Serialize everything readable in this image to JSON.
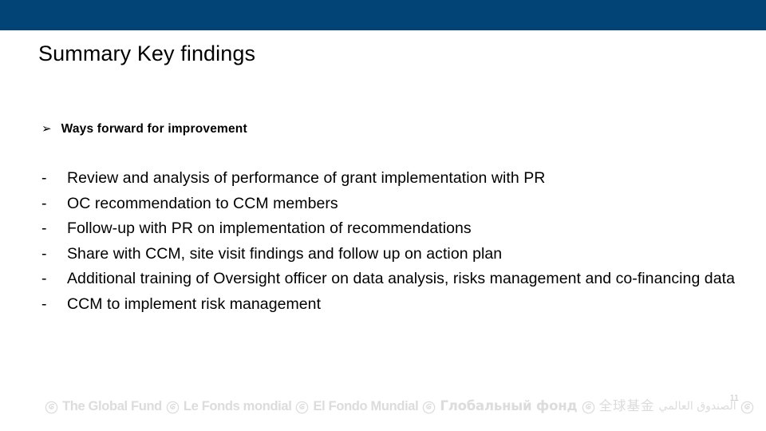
{
  "slide": {
    "title": "Summary Key findings",
    "headline": {
      "bullet_icon": "chevron-right-arrow-icon",
      "bullet_glyph": "➢",
      "text": "Ways forward for improvement"
    },
    "dash_mark": "-",
    "items": [
      "Review and analysis of performance of grant implementation with PR",
      "OC recommendation to CCM members",
      "Follow-up with PR on implementation of recommendations",
      "Share with CCM, site visit findings and follow up on action plan",
      "Additional training of Oversight officer on data analysis, risks management and co-financing data",
      "CCM to implement risk management"
    ],
    "page_number": "11"
  },
  "footer": {
    "logo_icon": "global-fund-spiral-logo-icon",
    "names": [
      "The Global Fund",
      "Le Fonds mondial",
      "El Fondo Mundial",
      "Глобальный фонд",
      "全球基金",
      "الصندوق العالمي"
    ]
  },
  "colors": {
    "header_bar": "#014475",
    "body_text": "#000000",
    "footer_text": "#dcdcdc",
    "page_number": "#c8c8c8",
    "background": "#ffffff"
  }
}
